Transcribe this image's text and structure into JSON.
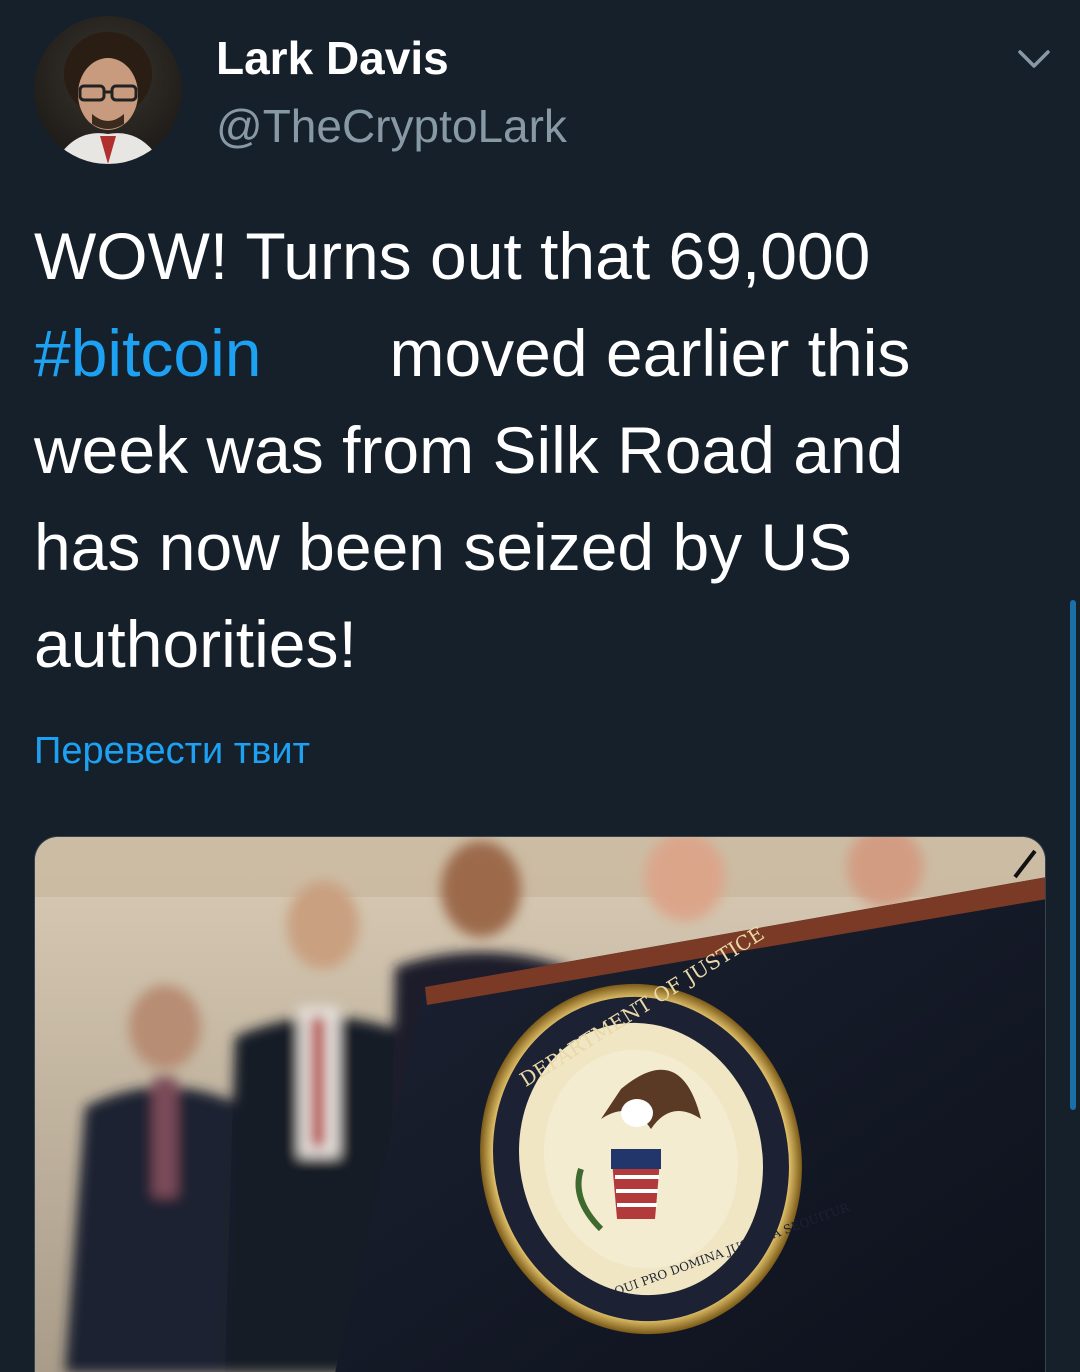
{
  "tweet": {
    "author": {
      "display_name": "Lark Davis",
      "handle": "@TheCryptoLark",
      "avatar_icon": "user-avatar-photo"
    },
    "menu_icon": "chevron-down-icon",
    "text_lines": [
      "WOW! Turns out that 69,000",
      "moved earlier this",
      "week was from Silk Road and",
      "has now been seized by US",
      "authorities!"
    ],
    "hashtag": "#bitcoin",
    "translate_label": "Перевести твит",
    "media": {
      "description_icon": "press-conference-photo",
      "seal_text_top": "DEPARTMENT OF JUSTICE",
      "seal_text_bottom": "QUI PRO DOMINA JUSTITIA SEQUITUR"
    }
  },
  "colors": {
    "background": "#15202b",
    "text": "#ffffff",
    "secondary_text": "#8899a6",
    "accent": "#1da1f2"
  }
}
